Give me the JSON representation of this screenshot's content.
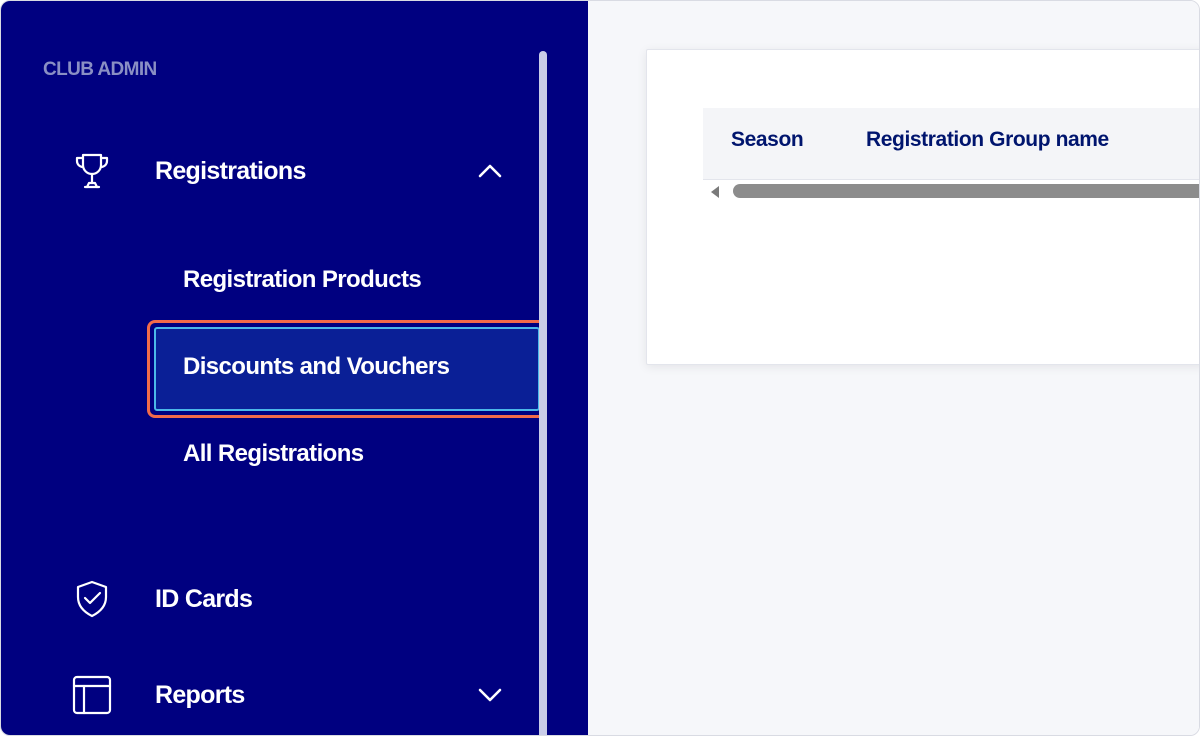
{
  "sidebar": {
    "section_label": "CLUB ADMIN",
    "items": [
      {
        "label": "Registrations",
        "icon": "trophy-icon",
        "expanded": true,
        "children": [
          {
            "label": "Registration Products"
          },
          {
            "label": "Discounts and Vouchers",
            "selected": true
          },
          {
            "label": "All Registrations"
          }
        ]
      },
      {
        "label": "ID Cards",
        "icon": "shield-check-icon"
      },
      {
        "label": "Reports",
        "icon": "layout-icon",
        "expanded": false
      }
    ]
  },
  "main": {
    "table": {
      "columns": [
        "Season",
        "Registration Group name"
      ]
    }
  },
  "colors": {
    "sidebar_bg": "#000080",
    "highlight_border": "#f26b4a",
    "selected_outline": "#4bb8e8",
    "header_text": "#00156e"
  }
}
